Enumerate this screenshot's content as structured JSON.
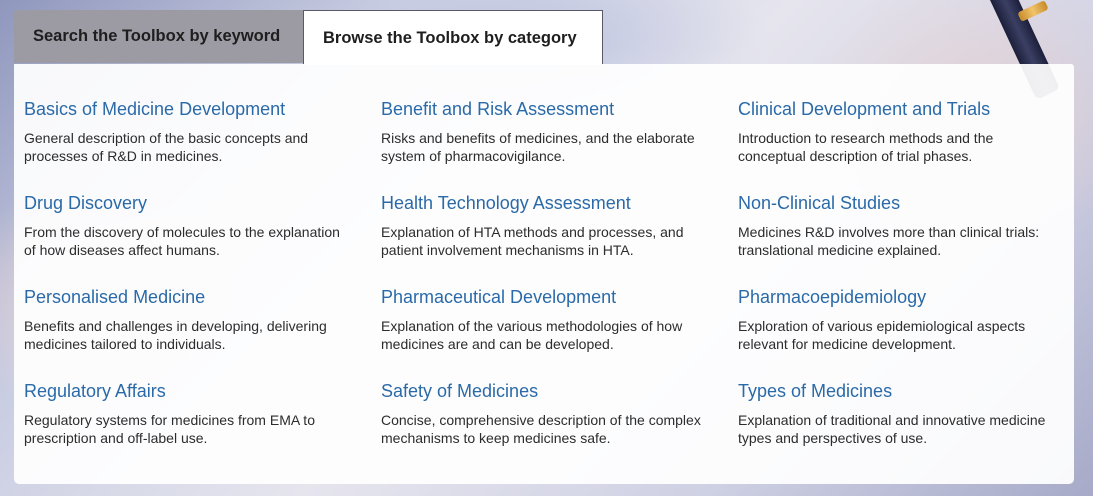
{
  "tabs": {
    "keyword": "Search the Toolbox by keyword",
    "category": "Browse the Toolbox by category"
  },
  "categories": [
    {
      "title": "Basics of Medicine Development",
      "desc": "General description of the basic concepts and processes of R&D in medicines."
    },
    {
      "title": "Benefit and Risk Assessment",
      "desc": "Risks and benefits of medicines, and the elaborate system of pharmacovigilance."
    },
    {
      "title": "Clinical Development and Trials",
      "desc": "Introduction to research methods and the conceptual description of trial phases."
    },
    {
      "title": "Drug Discovery",
      "desc": "From the discovery of molecules to the explanation of how diseases affect humans."
    },
    {
      "title": "Health Technology Assessment",
      "desc": "Explanation of HTA methods and processes, and patient involvement mechanisms in HTA."
    },
    {
      "title": "Non-Clinical Studies",
      "desc": "Medicines R&D involves more than clinical trials: translational medicine explained."
    },
    {
      "title": "Personalised Medicine",
      "desc": "Benefits and challenges in developing, delivering medicines tailored to individuals."
    },
    {
      "title": "Pharmaceutical Development",
      "desc": "Explanation of the various methodologies of how medicines are and can be developed."
    },
    {
      "title": "Pharmacoepidemiology",
      "desc": "Exploration of various epidemiological aspects relevant for medicine development."
    },
    {
      "title": "Regulatory Affairs",
      "desc": "Regulatory systems for medicines from EMA to prescription and off-label use."
    },
    {
      "title": "Safety of Medicines",
      "desc": "Concise, comprehensive description of the complex mechanisms to keep medicines safe."
    },
    {
      "title": "Types of Medicines",
      "desc": "Explanation of traditional and innovative medicine types and perspectives of use."
    }
  ]
}
